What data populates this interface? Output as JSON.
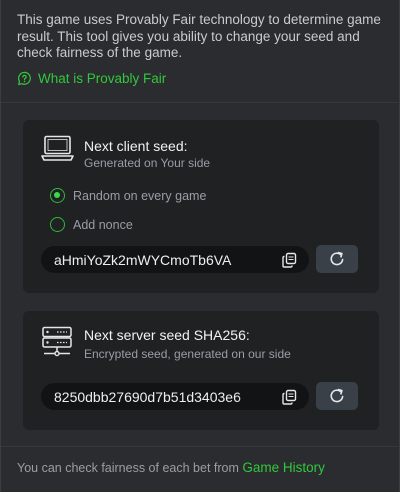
{
  "intro": {
    "text": "This game uses Provably Fair technology to determine game result. This tool gives you ability to change your seed and check fairness of the game.",
    "link_label": "What is Provably Fair"
  },
  "client_seed": {
    "title": "Next client seed:",
    "subtitle": "Generated on Your side",
    "options": [
      {
        "label": "Random on every game",
        "selected": true
      },
      {
        "label": "Add nonce",
        "selected": false
      }
    ],
    "value": "aHmiYoZk2mWYCmoTb6VA"
  },
  "server_seed": {
    "title": "Next server seed SHA256:",
    "subtitle": "Encrypted seed, generated on our side",
    "value": "8250dbb27690d7b51d3403e6"
  },
  "footer": {
    "text": "You can check fairness of each bet from ",
    "link_label": "Game History"
  },
  "colors": {
    "accent": "#33c73d",
    "background": "#2a2c2f",
    "card": "#1f2123"
  },
  "icons": [
    "chat-question-icon",
    "laptop-icon",
    "server-icon",
    "copy-icon",
    "refresh-icon"
  ]
}
